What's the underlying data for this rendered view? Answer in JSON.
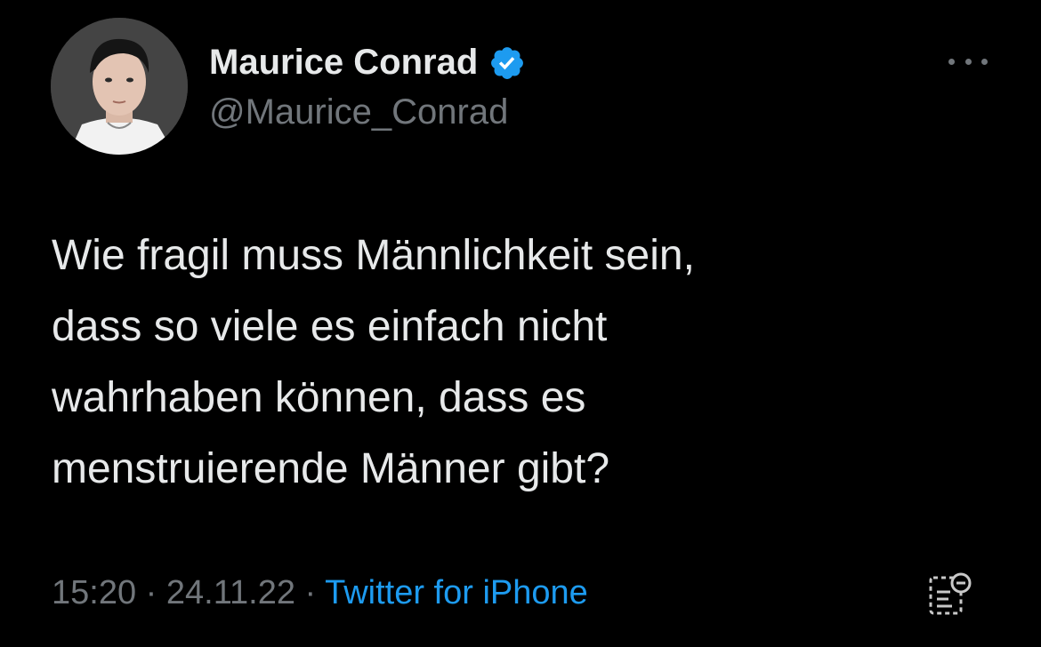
{
  "author": {
    "name": "Maurice Conrad",
    "handle": "@Maurice_Conrad",
    "verified": true
  },
  "tweet": {
    "lines": [
      "Wie fragil muss Männlichkeit sein,",
      "dass so viele es einfach nicht",
      "wahrhaben können, dass es",
      "menstruierende Männer gibt?"
    ]
  },
  "meta": {
    "time": "15:20",
    "separator": " · ",
    "date": "24.11.22",
    "source": "Twitter for iPhone"
  },
  "icons": {
    "verified": "verified-badge-icon",
    "more": "more-options-icon",
    "analytics": "tweet-analytics-icon"
  },
  "colors": {
    "background": "#000000",
    "text": "#e7e9ea",
    "secondary": "#71767b",
    "accent": "#1d9bf0"
  }
}
